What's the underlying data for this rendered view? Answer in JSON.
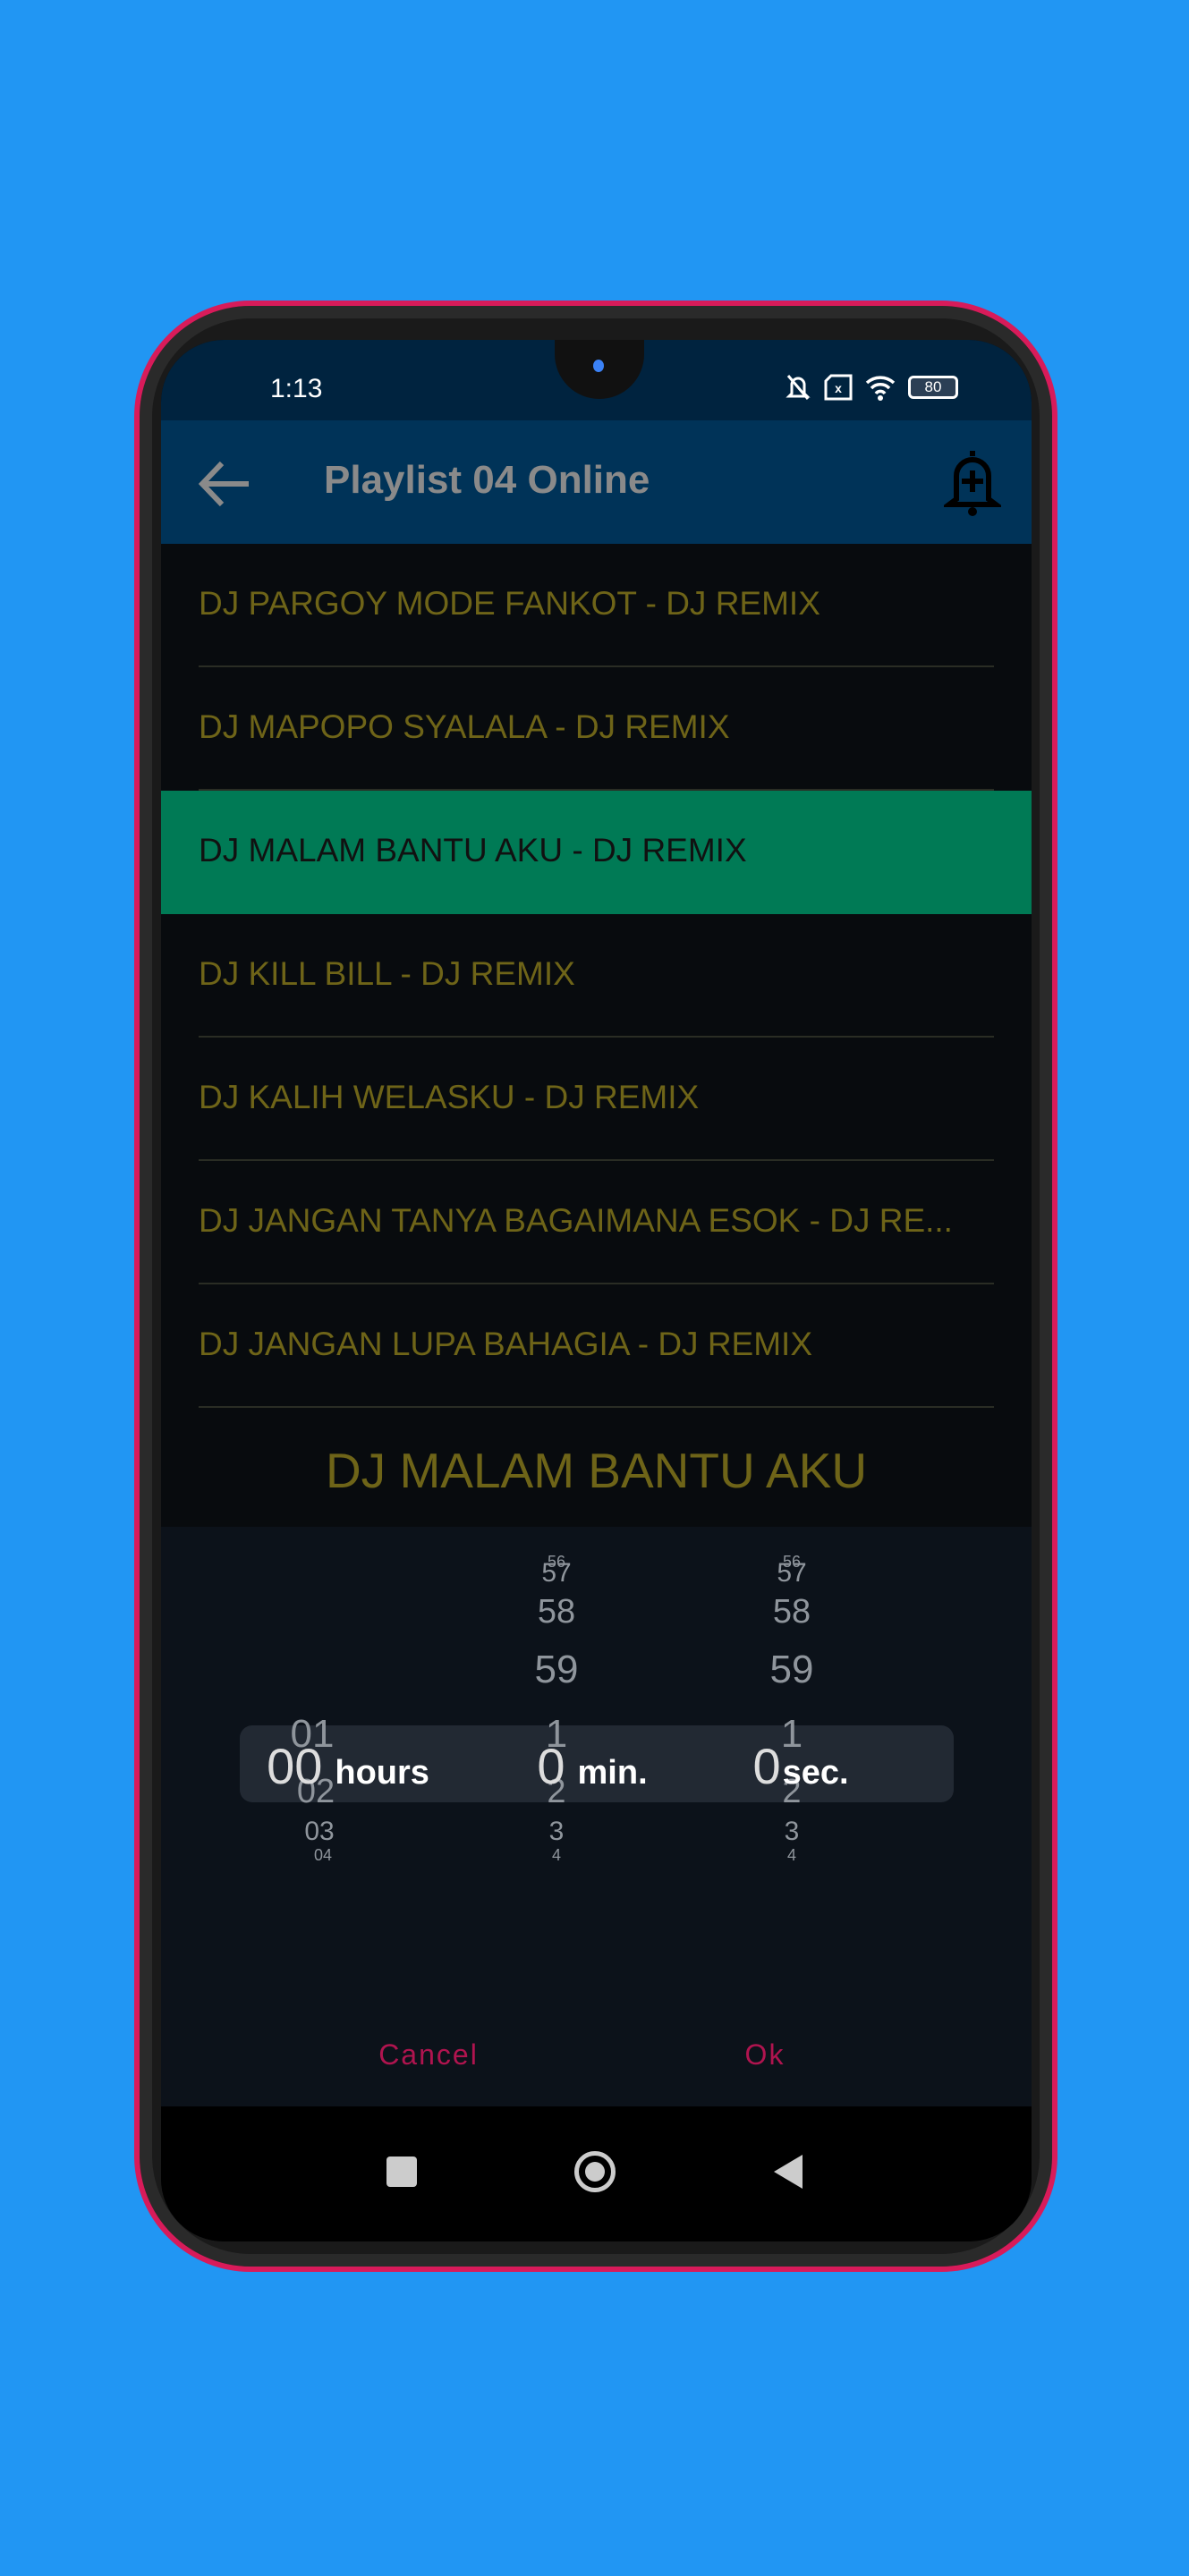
{
  "status_bar": {
    "time": "1:13",
    "battery": "80",
    "icons": [
      "bell-off-icon",
      "sim-missing-icon",
      "wifi-icon",
      "battery-icon"
    ]
  },
  "header": {
    "title": "Playlist 04 Online",
    "back_icon": "arrow-left-icon",
    "action_icon": "bell-plus-icon"
  },
  "playlist": [
    {
      "label": "DJ PARGOY MODE FANKOT - DJ REMIX",
      "selected": false
    },
    {
      "label": "DJ MAPOPO SYALALA - DJ REMIX",
      "selected": false
    },
    {
      "label": "DJ MALAM BANTU AKU - DJ REMIX",
      "selected": true
    },
    {
      "label": "DJ KILL BILL - DJ REMIX",
      "selected": false
    },
    {
      "label": "DJ KALIH WELASKU - DJ REMIX",
      "selected": false
    },
    {
      "label": "DJ JANGAN TANYA BAGAIMANA ESOK - DJ RE...",
      "selected": false
    },
    {
      "label": "DJ JANGAN LUPA BAHAGIA - DJ REMIX",
      "selected": false
    }
  ],
  "now_playing": "DJ MALAM BANTU AKU",
  "picker": {
    "hours": {
      "above": [],
      "value": "00",
      "unit": "hours",
      "below": [
        "01",
        "02",
        "03",
        "04"
      ]
    },
    "minutes": {
      "above": [
        "56",
        "57",
        "58",
        "59"
      ],
      "value": "0",
      "unit": "min.",
      "below": [
        "1",
        "2",
        "3",
        "4"
      ]
    },
    "seconds": {
      "above": [
        "56",
        "57",
        "58",
        "59"
      ],
      "value": "0",
      "unit": "sec.",
      "below": [
        "1",
        "2",
        "3",
        "4"
      ]
    },
    "cancel": "Cancel",
    "ok": "Ok"
  },
  "colors": {
    "background": "#2196f3",
    "header": "#003358",
    "selected_row": "#007a55",
    "accent": "#b0144f",
    "list_text": "#6e6418"
  }
}
